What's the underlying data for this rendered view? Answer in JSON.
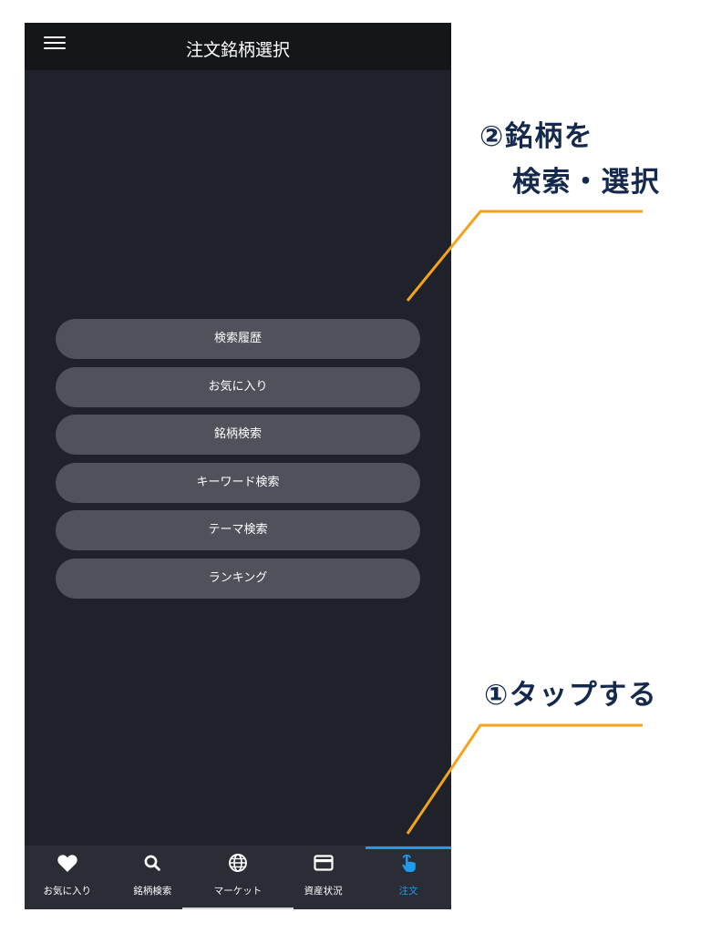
{
  "header": {
    "title": "注文銘柄選択",
    "menu_icon": "menu-icon"
  },
  "menu_buttons": [
    {
      "label": "検索履歴"
    },
    {
      "label": "お気に入り"
    },
    {
      "label": "銘柄検索"
    },
    {
      "label": "キーワード検索"
    },
    {
      "label": "テーマ検索"
    },
    {
      "label": "ランキング"
    }
  ],
  "bottom_nav": {
    "items": [
      {
        "label": "お気に入り",
        "icon": "heart-icon",
        "active": false
      },
      {
        "label": "銘柄検索",
        "icon": "search-icon",
        "active": false
      },
      {
        "label": "マーケット",
        "icon": "globe-icon",
        "active": false
      },
      {
        "label": "資産状況",
        "icon": "card-icon",
        "active": false
      },
      {
        "label": "注文",
        "icon": "tap-hand-icon",
        "active": true
      }
    ]
  },
  "annotations": {
    "step2": {
      "line1": "②銘柄を",
      "line2": "検索・選択"
    },
    "step1": {
      "text": "①タップする"
    }
  },
  "colors": {
    "page_bg": "#ffffff",
    "header_bg": "#15161a",
    "main_bg": "#1f222a",
    "button_bg": "#4f525b",
    "nav_bg": "#2a2d36",
    "nav_text": "#ffffff",
    "active": "#1e9cec",
    "annotation_text": "#14294d",
    "callout_line": "#f2a41b",
    "home_indicator": "#d9d9d9"
  }
}
